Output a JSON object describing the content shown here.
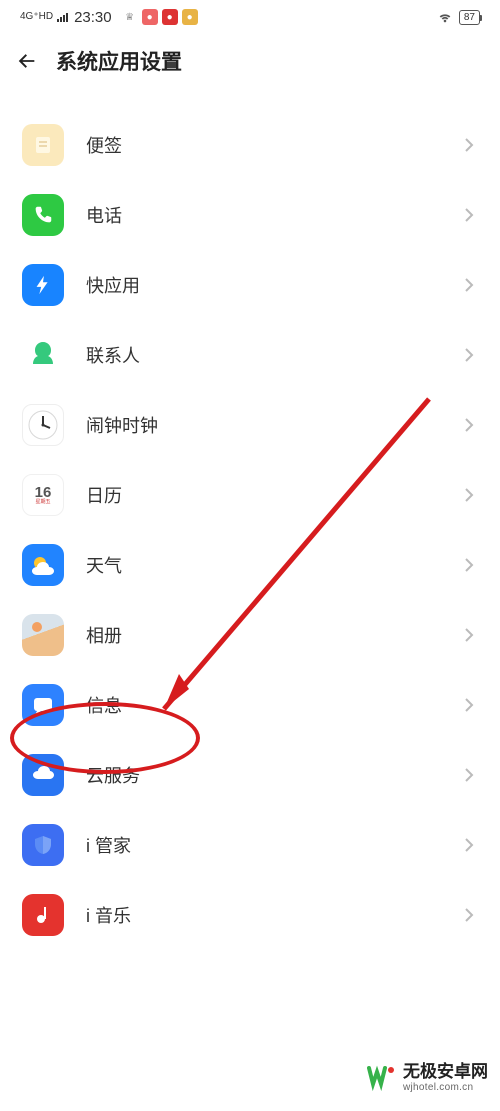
{
  "status": {
    "network": "4G⁺HD",
    "time": "23:30",
    "battery": "87"
  },
  "header": {
    "title": "系统应用设置"
  },
  "apps": {
    "note": {
      "label": "便签"
    },
    "phone": {
      "label": "电话"
    },
    "quick": {
      "label": "快应用"
    },
    "contact": {
      "label": "联系人"
    },
    "clock": {
      "label": "闹钟时钟"
    },
    "calendar": {
      "label": "日历",
      "day": "16"
    },
    "weather": {
      "label": "天气"
    },
    "gallery": {
      "label": "相册"
    },
    "message": {
      "label": "信息"
    },
    "cloud": {
      "label": "云服务"
    },
    "guard": {
      "label": "i 管家"
    },
    "music": {
      "label": "i 音乐"
    }
  },
  "watermark": {
    "cn": "无极安卓网",
    "en": "wjhotel.com.cn"
  }
}
